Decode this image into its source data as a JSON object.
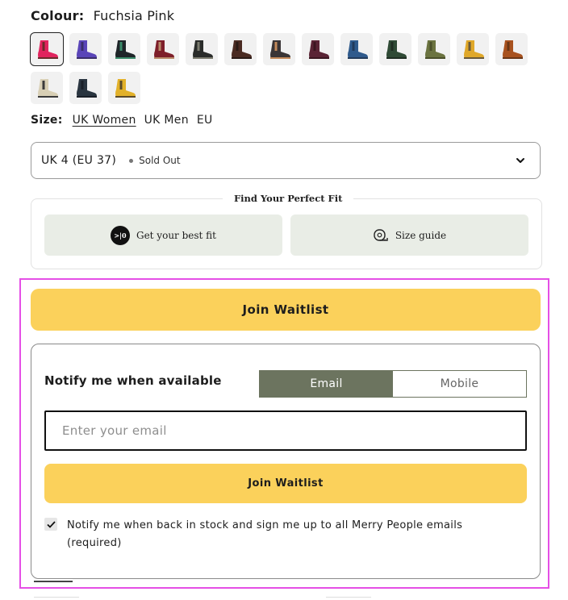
{
  "colour": {
    "label": "Colour:",
    "selected": "Fuchsia Pink",
    "swatches": [
      {
        "name": "Fuchsia Pink",
        "body": "#e1245e",
        "trim": "#6b2b2b",
        "selected": true
      },
      {
        "name": "Purple",
        "body": "#5a45b8",
        "trim": "#3a2e6a",
        "selected": false
      },
      {
        "name": "Black Green",
        "body": "#1f2529",
        "trim": "#3a8b6a",
        "selected": false
      },
      {
        "name": "Burgundy",
        "body": "#7e1f2a",
        "trim": "#b88b6a",
        "selected": false
      },
      {
        "name": "Black",
        "body": "#2a2c2a",
        "trim": "#7b7b6e",
        "selected": false
      },
      {
        "name": "Chocolate",
        "body": "#4a2b22",
        "trim": "#2a1a15",
        "selected": false
      },
      {
        "name": "Charcoal",
        "body": "#3a3536",
        "trim": "#c48a5a",
        "selected": false
      },
      {
        "name": "Plum",
        "body": "#5a2435",
        "trim": "#3a1620",
        "selected": false
      },
      {
        "name": "Blue",
        "body": "#2f5a8c",
        "trim": "#223a5a",
        "selected": false
      },
      {
        "name": "Forest Green",
        "body": "#2f4a35",
        "trim": "#1f2d22",
        "selected": false
      },
      {
        "name": "Olive",
        "body": "#6b7340",
        "trim": "#4a4f2a",
        "selected": false
      },
      {
        "name": "Mustard",
        "body": "#e0a82a",
        "trim": "#6a5a3a",
        "selected": false
      },
      {
        "name": "Tan",
        "body": "#a8521f",
        "trim": "#6a3616",
        "selected": false
      },
      {
        "name": "Cream",
        "body": "#d8cfb5",
        "trim": "#3a3a3a",
        "selected": false
      },
      {
        "name": "Navy",
        "body": "#2a3540",
        "trim": "#1a2028",
        "selected": false
      },
      {
        "name": "Yellow",
        "body": "#e2b12a",
        "trim": "#5a4a2a",
        "selected": false
      }
    ]
  },
  "size": {
    "label": "Size:",
    "options": [
      "UK Women",
      "UK Men",
      "EU"
    ],
    "active": "UK Women",
    "selected_value": "UK 4 (EU 37)",
    "selected_status": "Sold Out",
    "chevron_icon": "chevron-down-icon"
  },
  "fit": {
    "title": "Find Your Perfect Fit",
    "best_fit_label": "Get your best fit",
    "best_fit_icon_text": ">|0",
    "size_guide_label": "Size guide",
    "size_guide_icon": "measuring-tape-icon"
  },
  "waitlist": {
    "main_button": "Join Waitlist",
    "notify_title": "Notify me when available",
    "toggle": {
      "email": "Email",
      "mobile": "Mobile",
      "active": "Email"
    },
    "email_placeholder": "Enter your email",
    "email_value": "",
    "submit_button": "Join Waitlist",
    "consent_checked": true,
    "consent_label": "Notify me when back in stock and sign me up to all Merry People emails (required)"
  },
  "colors": {
    "accent_yellow": "#fbd15b",
    "toggle_green": "#6c745f",
    "fit_bg": "#e9ede6",
    "highlight": "#e54fe6"
  }
}
